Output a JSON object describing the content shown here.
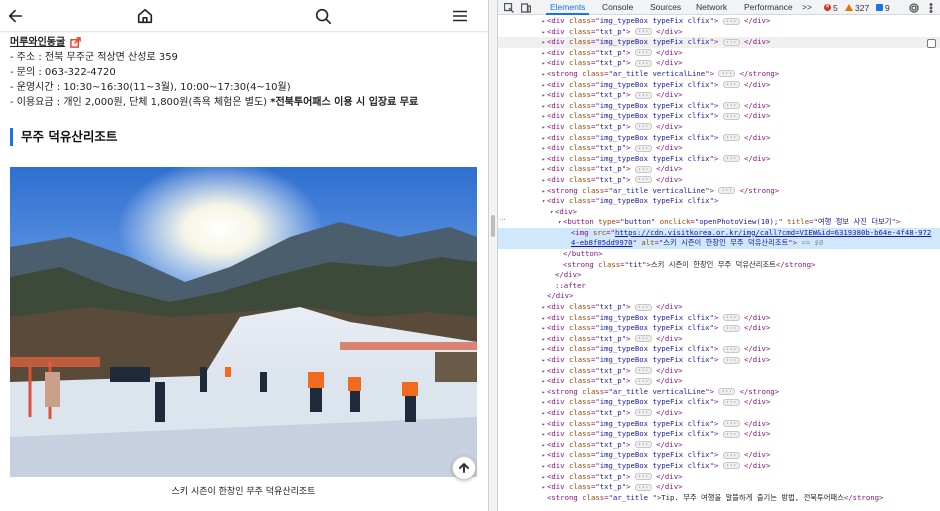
{
  "page": {
    "header": {
      "back_icon": "arrow-left-icon",
      "home_icon": "home-icon",
      "search_icon": "search-icon",
      "menu_icon": "hamburger-menu-icon"
    },
    "place_name": "머루와인동굴",
    "info_lines": [
      "- 주소 : 전북 무주군 적상면 산성로 359",
      "- 문의 : 063-322-4720",
      "- 운영시간 : 10:30~16:30(11~3월), 10:00~17:30(4~10월)"
    ],
    "fee_prefix": "- 이용요금 : 개인 2,000원, 단체 1,800원(족욕 체험은 별도) ",
    "fee_bold": "*전북투어패스 이용 시 입장료 무료",
    "section_title": "무주 덕유산리조트",
    "photo_caption": "스키 시즌이 한창인 무주 덕유산리조트",
    "top_button_icon": "arrow-up-icon"
  },
  "devtools": {
    "tabs": [
      "Elements",
      "Console",
      "Sources",
      "Network",
      "Performance"
    ],
    "active_tab": "Elements",
    "more_tabs": ">>",
    "errors": "5",
    "warnings": "327",
    "info": "9",
    "colors": {
      "error": "#d93025",
      "warning": "#e37400",
      "info": "#1a73e8",
      "accent": "#1a73e8"
    },
    "tree": [
      {
        "i": 0,
        "a": "▸",
        "tag": "div",
        "cls": "img_typeBox typeFix clfix"
      },
      {
        "i": 0,
        "a": "▸",
        "tag": "div",
        "cls": "txt_p"
      },
      {
        "i": 0,
        "a": "▸",
        "tag": "div",
        "cls": "img_typeBox typeFix clfix",
        "hover": true
      },
      {
        "i": 0,
        "a": "▸",
        "tag": "div",
        "cls": "txt_p"
      },
      {
        "i": 0,
        "a": "▸",
        "tag": "div",
        "cls": "txt_p"
      },
      {
        "i": 0,
        "a": "▸",
        "tag": "strong",
        "cls": "ar_title verticalLine"
      },
      {
        "i": 0,
        "a": "▸",
        "tag": "div",
        "cls": "img_typeBox typeFix clfix"
      },
      {
        "i": 0,
        "a": "▸",
        "tag": "div",
        "cls": "txt_p"
      },
      {
        "i": 0,
        "a": "▸",
        "tag": "div",
        "cls": "img_typeBox typeFix clfix"
      },
      {
        "i": 0,
        "a": "▸",
        "tag": "div",
        "cls": "img_typeBox typeFix clfix"
      },
      {
        "i": 0,
        "a": "▸",
        "tag": "div",
        "cls": "txt_p"
      },
      {
        "i": 0,
        "a": "▸",
        "tag": "div",
        "cls": "img_typeBox typeFix clfix"
      },
      {
        "i": 0,
        "a": "▸",
        "tag": "div",
        "cls": "txt_p"
      },
      {
        "i": 0,
        "a": "▸",
        "tag": "div",
        "cls": "img_typeBox typeFix clfix"
      },
      {
        "i": 0,
        "a": "▸",
        "tag": "div",
        "cls": "txt_p"
      },
      {
        "i": 0,
        "a": "▸",
        "tag": "div",
        "cls": "txt_p"
      },
      {
        "i": 0,
        "a": "▸",
        "tag": "strong",
        "cls": "ar_title verticalLine"
      },
      {
        "i": 0,
        "a": "▾",
        "tag": "div",
        "cls": "img_typeBox typeFix clfix",
        "open": true
      },
      {
        "i": 1,
        "a": "▾",
        "kind": "plain-open",
        "tag": "div"
      },
      {
        "i": 2,
        "a": "▾",
        "kind": "button",
        "type": "button",
        "onclick": "openPhotoView(10);",
        "title": "여행 정보 사진 더보기"
      },
      {
        "i": 3,
        "a": "",
        "kind": "img",
        "src": "https://cdn.visitkorea.or.kr/img/call?cmd=VIEW&id=6319380b-b64e-4f48-972",
        "alt": "스키 시즌이 한창인 무주 덕유산리조트",
        "selected": true
      },
      {
        "i": 3,
        "a": "",
        "kind": "img-cont",
        "src": "4-eb8f05dd9970",
        "alt": "스키 시즌이 한창인 무주 덕유산리조트",
        "eq": "== $0",
        "selected": true
      },
      {
        "i": 2,
        "a": "",
        "kind": "close",
        "tag": "button"
      },
      {
        "i": 2,
        "a": "",
        "kind": "strong-text",
        "cls": "tit",
        "text": "스키 시즌이 한창인 무주 덕유산리조트"
      },
      {
        "i": 1,
        "a": "",
        "kind": "close",
        "tag": "div"
      },
      {
        "i": 1,
        "a": "",
        "kind": "pseudo",
        "text": "::after"
      },
      {
        "i": 0,
        "a": "",
        "kind": "close",
        "tag": "div"
      },
      {
        "i": 0,
        "a": "▸",
        "tag": "div",
        "cls": "txt_p"
      },
      {
        "i": 0,
        "a": "▸",
        "tag": "div",
        "cls": "img_typeBox typeFix clfix"
      },
      {
        "i": 0,
        "a": "▸",
        "tag": "div",
        "cls": "img_typeBox typeFix clfix"
      },
      {
        "i": 0,
        "a": "▸",
        "tag": "div",
        "cls": "txt_p"
      },
      {
        "i": 0,
        "a": "▸",
        "tag": "div",
        "cls": "img_typeBox typeFix clfix"
      },
      {
        "i": 0,
        "a": "▸",
        "tag": "div",
        "cls": "img_typeBox typeFix clfix"
      },
      {
        "i": 0,
        "a": "▸",
        "tag": "div",
        "cls": "txt_p"
      },
      {
        "i": 0,
        "a": "▸",
        "tag": "div",
        "cls": "txt_p"
      },
      {
        "i": 0,
        "a": "▸",
        "tag": "strong",
        "cls": "ar_title verticalLine"
      },
      {
        "i": 0,
        "a": "▸",
        "tag": "div",
        "cls": "img_typeBox typeFix clfix"
      },
      {
        "i": 0,
        "a": "▸",
        "tag": "div",
        "cls": "txt_p"
      },
      {
        "i": 0,
        "a": "▸",
        "tag": "div",
        "cls": "img_typeBox typeFix clfix"
      },
      {
        "i": 0,
        "a": "▸",
        "tag": "div",
        "cls": "img_typeBox typeFix clfix"
      },
      {
        "i": 0,
        "a": "▸",
        "tag": "div",
        "cls": "txt_p"
      },
      {
        "i": 0,
        "a": "▸",
        "tag": "div",
        "cls": "img_typeBox typeFix clfix"
      },
      {
        "i": 0,
        "a": "▸",
        "tag": "div",
        "cls": "img_typeBox typeFix clfix"
      },
      {
        "i": 0,
        "a": "▸",
        "tag": "div",
        "cls": "txt_p"
      },
      {
        "i": 0,
        "a": "▸",
        "tag": "div",
        "cls": "txt_p"
      },
      {
        "i": 0,
        "a": "",
        "kind": "strong-text",
        "cls": "ar_title ",
        "text": "Tip. 무주 여행을 알뜰하게 즐기는 방법, 전북투어패스"
      }
    ]
  }
}
